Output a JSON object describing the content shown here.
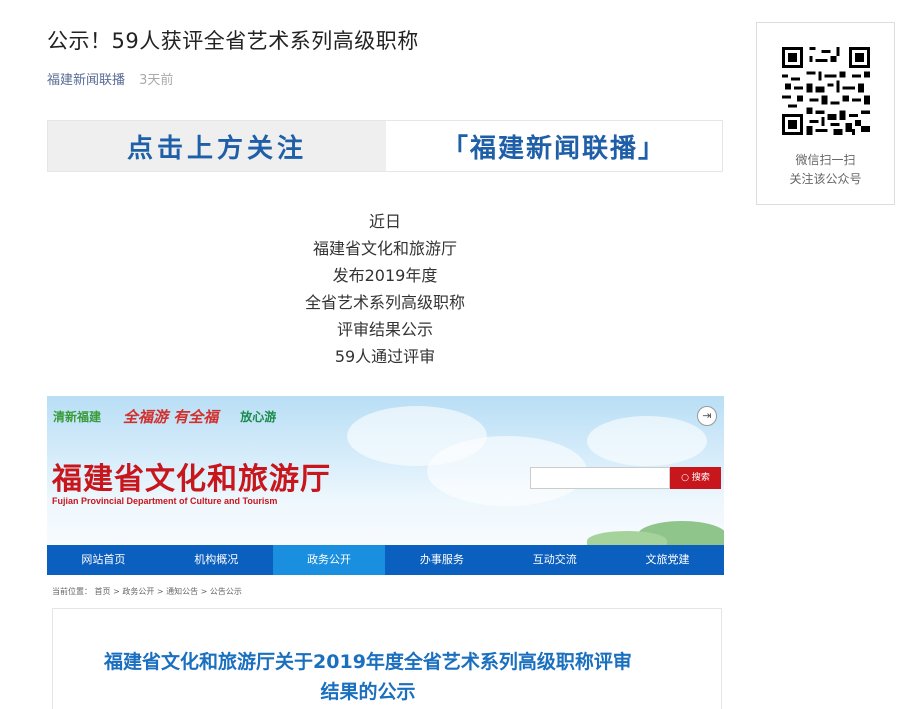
{
  "article": {
    "title": "公示！59人获评全省艺术系列高级职称",
    "account": "福建新闻联播",
    "time": "3天前"
  },
  "follow_banner": {
    "left_text": "点击上方关注",
    "right_text": "「福建新闻联播」"
  },
  "body_lines": [
    "近日",
    "福建省文化和旅游厅",
    "发布2019年度",
    "全省艺术系列高级职称",
    "评审结果公示",
    "59人通过评审"
  ],
  "qr": {
    "line1": "微信扫一扫",
    "line2": "关注该公众号"
  },
  "embedded_site": {
    "logo1": "清新福建",
    "logo2": "全福游 有全福",
    "logo3": "放心游",
    "title": "福建省文化和旅游厅",
    "subtitle": "Fujian Provincial Department of Culture and Tourism",
    "search_button": "搜索",
    "nav": [
      "网站首页",
      "机构概况",
      "政务公开",
      "办事服务",
      "互动交流",
      "文旅党建"
    ],
    "breadcrumb": "当前位置： 首页 > 政务公开 > 通知公告 > 公告公示",
    "notice_title_line1": "福建省文化和旅游厅关于2019年度全省艺术系列高级职称评审",
    "notice_title_line2": "结果的公示"
  }
}
